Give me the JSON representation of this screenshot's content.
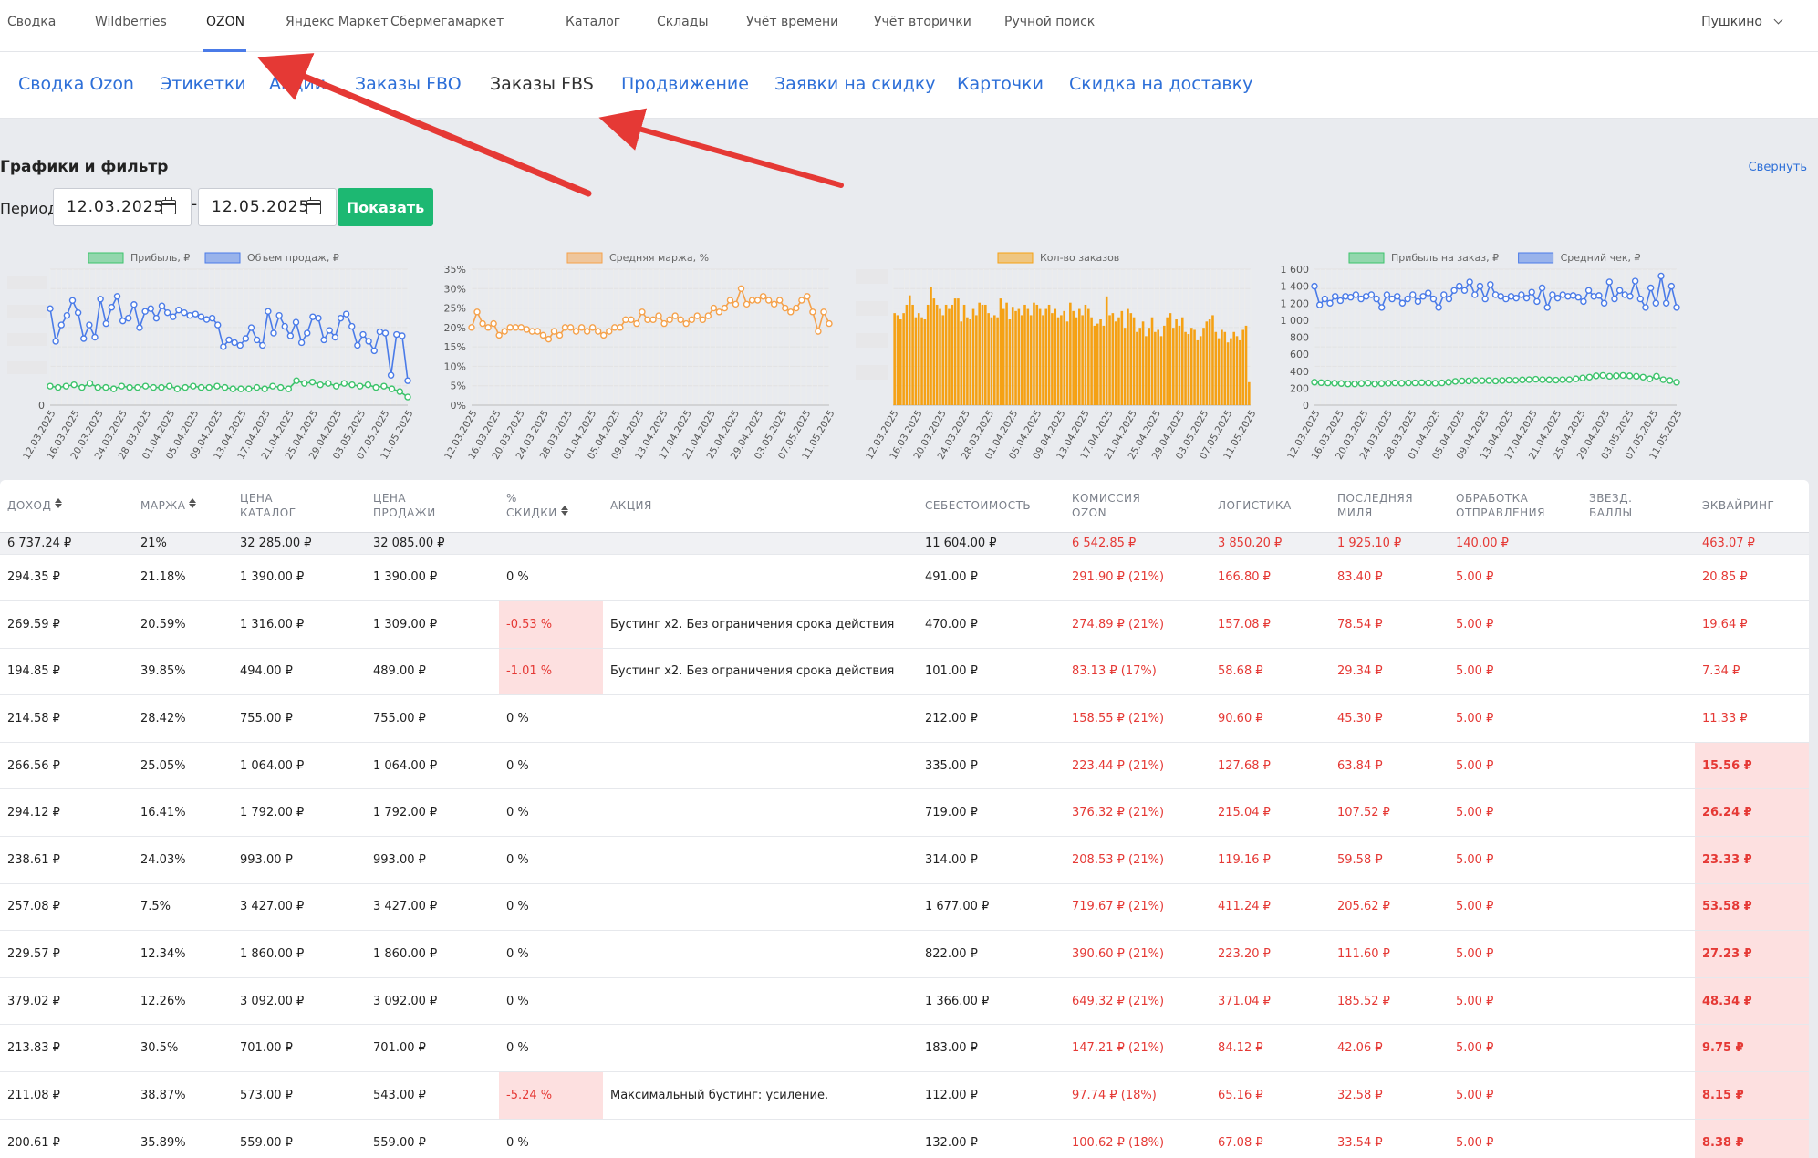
{
  "topnav": {
    "items": [
      "Сводка",
      "Wildberries",
      "OZON",
      "Яндекс Маркет",
      "Сбермегамаркет",
      "Каталог",
      "Склады",
      "Учёт времени",
      "Учёт вторички",
      "Ручной поиск"
    ],
    "active_index": 2,
    "city": "Пушкино"
  },
  "subnav": {
    "items": [
      "Сводка Ozon",
      "Этикетки",
      "Акции",
      "Заказы FBO",
      "Заказы FBS",
      "Продвижение",
      "Заявки на скидку",
      "Карточки",
      "Скидка на доставку"
    ],
    "active_index": 4
  },
  "filter": {
    "title": "Графики и фильтр",
    "collapse_label": "Свернуть",
    "period_label": "Период:",
    "date_from": "12.03.2025",
    "date_to": "12.05.2025",
    "separator": "-",
    "show_label": "Показать"
  },
  "chart_data": [
    {
      "type": "line",
      "legend": [
        "Прибыль, ₽",
        "Объем продаж, ₽"
      ],
      "colors": [
        "#3cc36b",
        "#4a7be8"
      ],
      "ytick_visible": "0",
      "x_ticks": [
        "12.03.2025",
        "16.03.2025",
        "20.03.2025",
        "24.03.2025",
        "28.03.2025",
        "01.04.2025",
        "05.04.2025",
        "09.04.2025",
        "13.04.2025",
        "17.04.2025",
        "21.04.2025",
        "25.04.2025",
        "29.04.2025",
        "03.05.2025",
        "07.05.2025",
        "11.05.2025"
      ],
      "series": [
        {
          "name": "Прибыль, ₽",
          "values": [
            14,
            13,
            14,
            15,
            13,
            16,
            13,
            13,
            12,
            14,
            13,
            13,
            14,
            13,
            13,
            14,
            12,
            13,
            14,
            13,
            13,
            14,
            13,
            12,
            12,
            12,
            13,
            12,
            14,
            13,
            12,
            18,
            16,
            17,
            15,
            16,
            14,
            16,
            15,
            14,
            15,
            13,
            14,
            12,
            10,
            6
          ]
        },
        {
          "name": "Объем продаж, ₽",
          "values": [
            71,
            47,
            59,
            66,
            77,
            68,
            49,
            59,
            50,
            78,
            60,
            72,
            80,
            62,
            64,
            74,
            57,
            69,
            71,
            64,
            73,
            68,
            65,
            70,
            68,
            66,
            67,
            65,
            63,
            64,
            59,
            43,
            48,
            46,
            44,
            49,
            57,
            48,
            44,
            69,
            53,
            66,
            58,
            51,
            61,
            46,
            53,
            65,
            64,
            48,
            55,
            50,
            64,
            67,
            58,
            44,
            52,
            47,
            40,
            54,
            53,
            22,
            52,
            51,
            18
          ]
        }
      ]
    },
    {
      "type": "line",
      "legend": [
        "Средняя маржа, %"
      ],
      "colors": [
        "#f5a14a"
      ],
      "y_ticks": [
        "0%",
        "5%",
        "10%",
        "15%",
        "20%",
        "25%",
        "30%",
        "35%"
      ],
      "ylim": [
        0,
        35
      ],
      "x_ticks": [
        "12.03.2025",
        "16.03.2025",
        "20.03.2025",
        "24.03.2025",
        "28.03.2025",
        "01.04.2025",
        "05.04.2025",
        "09.04.2025",
        "13.04.2025",
        "17.04.2025",
        "21.04.2025",
        "25.04.2025",
        "29.04.2025",
        "03.05.2025",
        "07.05.2025",
        "11.05.2025"
      ],
      "series": [
        {
          "name": "Средняя маржа, %",
          "values": [
            20,
            24,
            21,
            20,
            21,
            18,
            19,
            20,
            20,
            20,
            19.5,
            19,
            19,
            18,
            17,
            19,
            18,
            20,
            20,
            19,
            20,
            19,
            20,
            19,
            18,
            19,
            20,
            20,
            22,
            22,
            21,
            24,
            22,
            22,
            23,
            21,
            22,
            23,
            22,
            21,
            22,
            23,
            22,
            23,
            25,
            24,
            25,
            27,
            26,
            30,
            26,
            27,
            27,
            28,
            27,
            26,
            27,
            25,
            24,
            25,
            27,
            28,
            24,
            19,
            24,
            21
          ]
        }
      ]
    },
    {
      "type": "bar",
      "legend": [
        "Кол-во заказов"
      ],
      "colors": [
        "#f5a114"
      ],
      "x_ticks": [
        "12.03.2025",
        "16.03.2025",
        "20.03.2025",
        "24.03.2025",
        "28.03.2025",
        "01.04.2025",
        "05.04.2025",
        "09.04.2025",
        "13.04.2025",
        "17.04.2025",
        "21.04.2025",
        "25.04.2025",
        "29.04.2025",
        "03.05.2025",
        "07.05.2025",
        "11.05.2025"
      ],
      "values": [
        88,
        86,
        82,
        88,
        96,
        105,
        96,
        84,
        88,
        84,
        82,
        96,
        113,
        102,
        96,
        92,
        86,
        96,
        92,
        96,
        102,
        102,
        80,
        96,
        84,
        82,
        92,
        86,
        98,
        96,
        96,
        88,
        84,
        86,
        84,
        102,
        92,
        98,
        82,
        94,
        90,
        92,
        86,
        96,
        92,
        86,
        98,
        96,
        92,
        86,
        92,
        96,
        88,
        92,
        84,
        86,
        90,
        80,
        98,
        90,
        84,
        92,
        86,
        96,
        92,
        84,
        76,
        78,
        82,
        76,
        104,
        86,
        88,
        80,
        84,
        90,
        74,
        92,
        88,
        84,
        70,
        74,
        80,
        66,
        74,
        84,
        70,
        72,
        66,
        76,
        84,
        88,
        74,
        82,
        76,
        84,
        70,
        68,
        74,
        72,
        62,
        66,
        74,
        80,
        82,
        86,
        70,
        64,
        72,
        70,
        60,
        64,
        70,
        66,
        62,
        72,
        76,
        22
      ]
    },
    {
      "type": "line",
      "legend": [
        "Прибыль на заказ, ₽",
        "Средний чек, ₽"
      ],
      "colors": [
        "#3cc36b",
        "#4a7be8"
      ],
      "y_ticks": [
        "0",
        "200",
        "400",
        "600",
        "800",
        "1 000",
        "1 200",
        "1 400",
        "1 600"
      ],
      "ylim": [
        0,
        1600
      ],
      "x_ticks": [
        "12.03.2025",
        "16.03.2025",
        "20.03.2025",
        "24.03.2025",
        "28.03.2025",
        "01.04.2025",
        "05.04.2025",
        "09.04.2025",
        "13.04.2025",
        "17.04.2025",
        "21.04.2025",
        "25.04.2025",
        "29.04.2025",
        "03.05.2025",
        "07.05.2025",
        "11.05.2025"
      ],
      "series": [
        {
          "name": "Прибыль на заказ, ₽",
          "values": [
            270,
            265,
            262,
            258,
            255,
            250,
            250,
            255,
            260,
            250,
            255,
            258,
            262,
            258,
            262,
            262,
            265,
            262,
            258,
            262,
            270,
            280,
            285,
            285,
            290,
            288,
            290,
            285,
            290,
            295,
            292,
            298,
            300,
            305,
            300,
            298,
            295,
            300,
            300,
            310,
            320,
            330,
            345,
            350,
            340,
            345,
            350,
            345,
            340,
            330,
            310,
            340,
            300,
            290,
            270
          ]
        },
        {
          "name": "Средний чек, ₽",
          "values": [
            1400,
            1180,
            1250,
            1200,
            1280,
            1230,
            1280,
            1270,
            1300,
            1250,
            1280,
            1300,
            1250,
            1150,
            1300,
            1250,
            1280,
            1200,
            1250,
            1300,
            1220,
            1280,
            1320,
            1250,
            1150,
            1300,
            1250,
            1350,
            1400,
            1350,
            1450,
            1300,
            1400,
            1250,
            1420,
            1300,
            1280,
            1250,
            1280,
            1260,
            1300,
            1260,
            1330,
            1220,
            1380,
            1150,
            1300,
            1260,
            1300,
            1280,
            1290,
            1270,
            1220,
            1350,
            1280,
            1290,
            1200,
            1450,
            1250,
            1350,
            1300,
            1280,
            1460,
            1250,
            1150,
            1380,
            1200,
            1520,
            1200,
            1400,
            1150
          ]
        }
      ]
    }
  ],
  "table": {
    "headers": [
      "ДОХОД",
      "МАРЖА",
      "ЦЕНА КАТАЛОГ",
      "ЦЕНА ПРОДАЖИ",
      "% СКИДКИ",
      "АКЦИЯ",
      "СЕБЕСТОИМОСТЬ",
      "КОМИССИЯ OZON",
      "ЛОГИСТИКА",
      "ПОСЛЕДНЯЯ МИЛЯ",
      "ОБРАБОТКА ОТПРАВЛЕНИЯ",
      "ЗВЕЗД. БАЛЛЫ",
      "ЭКВАЙРИНГ"
    ],
    "header_lines": [
      [
        "ДОХОД"
      ],
      [
        "МАРЖА"
      ],
      [
        "ЦЕНА",
        "КАТАЛОГ"
      ],
      [
        "ЦЕНА",
        "ПРОДАЖИ"
      ],
      [
        "%",
        "СКИДКИ"
      ],
      [
        "АКЦИЯ"
      ],
      [
        "СЕБЕСТОИМОСТЬ"
      ],
      [
        "КОМИССИЯ",
        "OZON"
      ],
      [
        "ЛОГИСТИКА"
      ],
      [
        "ПОСЛЕДНЯЯ",
        "МИЛЯ"
      ],
      [
        "ОБРАБОТКА",
        "ОТПРАВЛЕНИЯ"
      ],
      [
        "ЗВЕЗД.",
        "БАЛЛЫ"
      ],
      [
        "ЭКВАЙРИНГ"
      ]
    ],
    "totals": [
      "6 737.24 ₽",
      "21%",
      "32 285.00 ₽",
      "32 085.00 ₽",
      "",
      "",
      "11 604.00 ₽",
      "6 542.85 ₽",
      "3 850.20 ₽",
      "1 925.10 ₽",
      "140.00 ₽",
      "",
      "463.07 ₽"
    ],
    "rows": [
      [
        "294.35 ₽",
        "21.18%",
        "1 390.00 ₽",
        "1 390.00 ₽",
        "0 %",
        "",
        "491.00 ₽",
        "291.90 ₽ (21%)",
        "166.80 ₽",
        "83.40 ₽",
        "5.00 ₽",
        "",
        "20.85 ₽"
      ],
      [
        "269.59 ₽",
        "20.59%",
        "1 316.00 ₽",
        "1 309.00 ₽",
        "-0.53 %",
        "Бустинг x2. Без ограничения срока действия",
        "470.00 ₽",
        "274.89 ₽ (21%)",
        "157.08 ₽",
        "78.54 ₽",
        "5.00 ₽",
        "",
        "19.64 ₽"
      ],
      [
        "194.85 ₽",
        "39.85%",
        "494.00 ₽",
        "489.00 ₽",
        "-1.01 %",
        "Бустинг x2. Без ограничения срока действия",
        "101.00 ₽",
        "83.13 ₽ (17%)",
        "58.68 ₽",
        "29.34 ₽",
        "5.00 ₽",
        "",
        "7.34 ₽"
      ],
      [
        "214.58 ₽",
        "28.42%",
        "755.00 ₽",
        "755.00 ₽",
        "0 %",
        "",
        "212.00 ₽",
        "158.55 ₽ (21%)",
        "90.60 ₽",
        "45.30 ₽",
        "5.00 ₽",
        "",
        "11.33 ₽"
      ],
      [
        "266.56 ₽",
        "25.05%",
        "1 064.00 ₽",
        "1 064.00 ₽",
        "0 %",
        "",
        "335.00 ₽",
        "223.44 ₽ (21%)",
        "127.68 ₽",
        "63.84 ₽",
        "5.00 ₽",
        "",
        "15.56 ₽"
      ],
      [
        "294.12 ₽",
        "16.41%",
        "1 792.00 ₽",
        "1 792.00 ₽",
        "0 %",
        "",
        "719.00 ₽",
        "376.32 ₽ (21%)",
        "215.04 ₽",
        "107.52 ₽",
        "5.00 ₽",
        "",
        "26.24 ₽"
      ],
      [
        "238.61 ₽",
        "24.03%",
        "993.00 ₽",
        "993.00 ₽",
        "0 %",
        "",
        "314.00 ₽",
        "208.53 ₽ (21%)",
        "119.16 ₽",
        "59.58 ₽",
        "5.00 ₽",
        "",
        "23.33 ₽"
      ],
      [
        "257.08 ₽",
        "7.5%",
        "3 427.00 ₽",
        "3 427.00 ₽",
        "0 %",
        "",
        "1 677.00 ₽",
        "719.67 ₽ (21%)",
        "411.24 ₽",
        "205.62 ₽",
        "5.00 ₽",
        "",
        "53.58 ₽"
      ],
      [
        "229.57 ₽",
        "12.34%",
        "1 860.00 ₽",
        "1 860.00 ₽",
        "0 %",
        "",
        "822.00 ₽",
        "390.60 ₽ (21%)",
        "223.20 ₽",
        "111.60 ₽",
        "5.00 ₽",
        "",
        "27.23 ₽"
      ],
      [
        "379.02 ₽",
        "12.26%",
        "3 092.00 ₽",
        "3 092.00 ₽",
        "0 %",
        "",
        "1 366.00 ₽",
        "649.32 ₽ (21%)",
        "371.04 ₽",
        "185.52 ₽",
        "5.00 ₽",
        "",
        "48.34 ₽"
      ],
      [
        "213.83 ₽",
        "30.5%",
        "701.00 ₽",
        "701.00 ₽",
        "0 %",
        "",
        "183.00 ₽",
        "147.21 ₽ (21%)",
        "84.12 ₽",
        "42.06 ₽",
        "5.00 ₽",
        "",
        "9.75 ₽"
      ],
      [
        "211.08 ₽",
        "38.87%",
        "573.00 ₽",
        "543.00 ₽",
        "-5.24 %",
        "Максимальный бустинг: усиление.",
        "112.00 ₽",
        "97.74 ₽ (18%)",
        "65.16 ₽",
        "32.58 ₽",
        "5.00 ₽",
        "",
        "8.15 ₽"
      ],
      [
        "200.61 ₽",
        "35.89%",
        "559.00 ₽",
        "559.00 ₽",
        "0 %",
        "",
        "132.00 ₽",
        "100.62 ₽ (18%)",
        "67.08 ₽",
        "33.54 ₽",
        "5.00 ₽",
        "",
        "8.38 ₽"
      ]
    ],
    "highlight_acquiring_from_row": 4
  },
  "colors": {
    "accent_blue": "#2d6fd8",
    "show_button": "#1db872",
    "red_text": "#e53935",
    "highlight_bg": "#fde0e0",
    "arrow": "#e53935"
  }
}
